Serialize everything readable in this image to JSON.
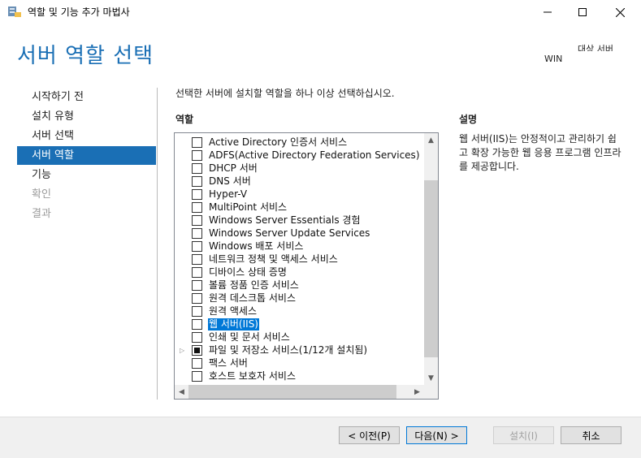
{
  "window": {
    "title": "역할 및 기능 추가 마법사",
    "icon": "server-manager-icon",
    "controls": {
      "minimize": "minimize-icon",
      "maximize": "maximize-icon",
      "close": "close-icon"
    }
  },
  "header": {
    "page_title": "서버 역할 선택",
    "target_label": "대상 서버",
    "target_server": "WIN-"
  },
  "nav": {
    "items": [
      {
        "label": "시작하기 전",
        "state": "normal"
      },
      {
        "label": "설치 유형",
        "state": "normal"
      },
      {
        "label": "서버 선택",
        "state": "normal"
      },
      {
        "label": "서버 역할",
        "state": "active"
      },
      {
        "label": "기능",
        "state": "normal"
      },
      {
        "label": "확인",
        "state": "disabled"
      },
      {
        "label": "결과",
        "state": "disabled"
      }
    ]
  },
  "main": {
    "instruction": "선택한 서버에 설치할 역할을 하나 이상 선택하십시오.",
    "roles_label": "역할",
    "description_label": "설명",
    "description_text": "웹 서버(IIS)는 안정적이고 관리하기 쉽고 확장 가능한 웹 응용 프로그램 인프라를 제공합니다.",
    "roles": [
      {
        "label": "Active Directory 인증서 서비스",
        "checked": false,
        "selected": false,
        "expandable": false
      },
      {
        "label": "ADFS(Active Directory Federation Services)",
        "checked": false,
        "selected": false,
        "expandable": false
      },
      {
        "label": "DHCP 서버",
        "checked": false,
        "selected": false,
        "expandable": false
      },
      {
        "label": "DNS 서버",
        "checked": false,
        "selected": false,
        "expandable": false
      },
      {
        "label": "Hyper-V",
        "checked": false,
        "selected": false,
        "expandable": false
      },
      {
        "label": "MultiPoint 서비스",
        "checked": false,
        "selected": false,
        "expandable": false
      },
      {
        "label": "Windows Server Essentials 경험",
        "checked": false,
        "selected": false,
        "expandable": false
      },
      {
        "label": "Windows Server Update Services",
        "checked": false,
        "selected": false,
        "expandable": false
      },
      {
        "label": "Windows 배포 서비스",
        "checked": false,
        "selected": false,
        "expandable": false
      },
      {
        "label": "네트워크 정책 및 액세스 서비스",
        "checked": false,
        "selected": false,
        "expandable": false
      },
      {
        "label": "디바이스 상태 증명",
        "checked": false,
        "selected": false,
        "expandable": false
      },
      {
        "label": "볼륨 정품 인증 서비스",
        "checked": false,
        "selected": false,
        "expandable": false
      },
      {
        "label": "원격 데스크톱 서비스",
        "checked": false,
        "selected": false,
        "expandable": false
      },
      {
        "label": "원격 액세스",
        "checked": false,
        "selected": false,
        "expandable": false
      },
      {
        "label": "웹 서버(IIS)",
        "checked": false,
        "selected": true,
        "expandable": false
      },
      {
        "label": "인쇄 및 문서 서비스",
        "checked": false,
        "selected": false,
        "expandable": false
      },
      {
        "label": "파일 및 저장소 서비스(1/12개 설치됨)",
        "checked": "partial",
        "selected": false,
        "expandable": true
      },
      {
        "label": "팩스 서버",
        "checked": false,
        "selected": false,
        "expandable": false
      },
      {
        "label": "호스트 보호자 서비스",
        "checked": false,
        "selected": false,
        "expandable": false
      }
    ]
  },
  "footer": {
    "prev_label": "< 이전(P)",
    "next_label": "다음(N) >",
    "install_label": "설치(I)",
    "cancel_label": "취소"
  }
}
